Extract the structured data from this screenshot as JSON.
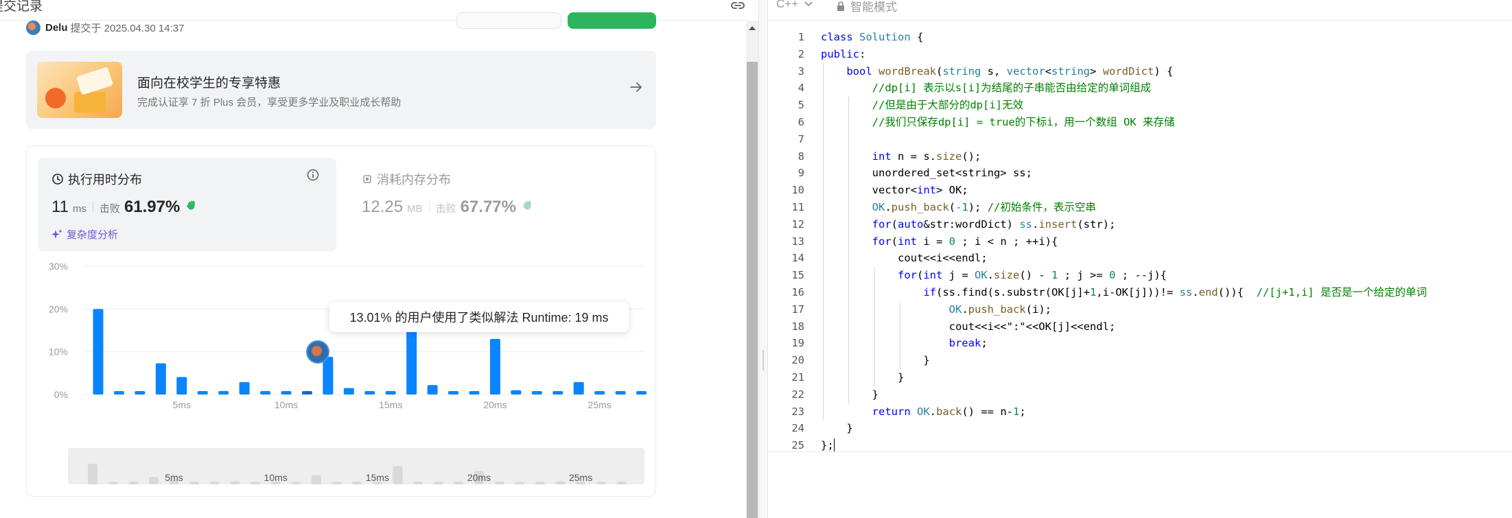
{
  "header": {
    "title": "提交记录"
  },
  "submission": {
    "author": "Delu",
    "submitted_at": "提交于 2025.04.30 14:37"
  },
  "promo": {
    "title": "面向在校学生的专享特惠",
    "subtitle": "完成认证享 7 折 Plus 会员，享受更多学业及职业成长帮助"
  },
  "runtime": {
    "title": "执行用时分布",
    "value": "11",
    "unit": "ms",
    "beat_label": "击败",
    "beat_pct": "61.97%",
    "complexity_label": "复杂度分析"
  },
  "memory": {
    "title": "消耗内存分布",
    "value": "12.25",
    "unit": "MB",
    "beat_label": "击败",
    "beat_pct": "67.77%"
  },
  "tooltip": {
    "text": "13.01% 的用户使用了类似解法 Runtime: 19 ms"
  },
  "chart_data": {
    "type": "bar",
    "xlabel": "",
    "ylabel": "",
    "ylim": [
      0,
      30
    ],
    "y_ticks": [
      "0%",
      "10%",
      "20%",
      "30%"
    ],
    "x_ticks": [
      "5ms",
      "10ms",
      "15ms",
      "20ms",
      "25ms"
    ],
    "x": [
      1,
      2,
      3,
      4,
      5,
      6,
      7,
      8,
      9,
      10,
      11,
      12,
      13,
      14,
      15,
      16,
      17,
      18,
      19,
      20,
      21,
      22,
      23,
      24,
      25,
      26,
      27
    ],
    "values": [
      20,
      0.8,
      0.8,
      7.3,
      4.1,
      0.8,
      0.8,
      2.9,
      0.8,
      0.8,
      0.8,
      8.8,
      1.5,
      0.8,
      0.8,
      18,
      2.2,
      0.8,
      0.8,
      13,
      1.0,
      0.8,
      0.8,
      2.9,
      0.8,
      0.8,
      0.8
    ],
    "highlight_x": 11,
    "grid": true
  },
  "editor": {
    "language": "C++",
    "mode": "智能模式",
    "lines": [
      [
        [
          "kw",
          "class "
        ],
        [
          "ty",
          "Solution"
        ],
        [
          "p",
          " {"
        ]
      ],
      [
        [
          "kw",
          "public"
        ],
        [
          "p",
          ":"
        ]
      ],
      [
        [
          "p",
          "    "
        ],
        [
          "kw",
          "bool "
        ],
        [
          "fn",
          "wordBreak"
        ],
        [
          "p",
          "("
        ],
        [
          "ty",
          "string"
        ],
        [
          "p",
          " s, "
        ],
        [
          "ty",
          "vector"
        ],
        [
          "p",
          "<"
        ],
        [
          "ty",
          "string"
        ],
        [
          "p",
          "&gt; "
        ],
        [
          "fn",
          "wordDict"
        ],
        [
          "p",
          ") {"
        ]
      ],
      [
        [
          "p",
          "        "
        ],
        [
          "cm",
          "//dp[i] 表示以s[i]为结尾的子串能否由给定的单词组成"
        ]
      ],
      [
        [
          "p",
          "        "
        ],
        [
          "cm",
          "//但是由于大部分的dp[i]无效"
        ]
      ],
      [
        [
          "p",
          "        "
        ],
        [
          "cm",
          "//我们只保存dp[i] = true的下标i，用一个数组 OK 来存储"
        ]
      ],
      [
        [
          "p",
          ""
        ]
      ],
      [
        [
          "p",
          "        "
        ],
        [
          "kw",
          "int"
        ],
        [
          "p",
          " n = s."
        ],
        [
          "fn",
          "size"
        ],
        [
          "p",
          "();"
        ]
      ],
      [
        [
          "p",
          "        unordered_set&lt;string&gt; ss;"
        ]
      ],
      [
        [
          "p",
          "        vector&lt;"
        ],
        [
          "kw",
          "int"
        ],
        [
          "p",
          "&gt; OK;"
        ]
      ],
      [
        [
          "p",
          "        "
        ],
        [
          "ty",
          "OK"
        ],
        [
          "p",
          "."
        ],
        [
          "fn",
          "push_back"
        ],
        [
          "p",
          "("
        ],
        [
          "nm",
          "-1"
        ],
        [
          "p",
          "); "
        ],
        [
          "cm",
          "//初始条件，表示空串"
        ]
      ],
      [
        [
          "p",
          "        "
        ],
        [
          "kw",
          "for"
        ],
        [
          "p",
          "("
        ],
        [
          "kw",
          "auto"
        ],
        [
          "p",
          "&amp;str:wordDict) "
        ],
        [
          "ty",
          "ss"
        ],
        [
          "p",
          "."
        ],
        [
          "fn",
          "insert"
        ],
        [
          "p",
          "(str);"
        ]
      ],
      [
        [
          "p",
          "        "
        ],
        [
          "kw",
          "for"
        ],
        [
          "p",
          "("
        ],
        [
          "kw",
          "int"
        ],
        [
          "p",
          " i = "
        ],
        [
          "nm",
          "0"
        ],
        [
          "p",
          " ; i &lt; n ; ++i){"
        ]
      ],
      [
        [
          "p",
          "            cout&lt;&lt;i&lt;&lt;endl;"
        ]
      ],
      [
        [
          "p",
          "            "
        ],
        [
          "kw",
          "for"
        ],
        [
          "p",
          "("
        ],
        [
          "kw",
          "int"
        ],
        [
          "p",
          " j = "
        ],
        [
          "ty",
          "OK"
        ],
        [
          "p",
          "."
        ],
        [
          "fn",
          "size"
        ],
        [
          "p",
          "() - "
        ],
        [
          "nm",
          "1"
        ],
        [
          "p",
          " ; j &gt;= "
        ],
        [
          "nm",
          "0"
        ],
        [
          "p",
          " ; --j){"
        ]
      ],
      [
        [
          "p",
          "                "
        ],
        [
          "kw",
          "if"
        ],
        [
          "p",
          "(ss.find(s.substr(OK[j]+"
        ],
        [
          "nm",
          "1"
        ],
        [
          "p",
          ",i-OK[j]))!= "
        ],
        [
          "ty",
          "ss"
        ],
        [
          "p",
          "."
        ],
        [
          "fn",
          "end"
        ],
        [
          "p",
          "()){  "
        ],
        [
          "cm",
          "//[j+1,i] 是否是一个给定的单词"
        ]
      ],
      [
        [
          "p",
          "                    "
        ],
        [
          "ty",
          "OK"
        ],
        [
          "p",
          "."
        ],
        [
          "fn",
          "push_back"
        ],
        [
          "p",
          "(i);"
        ]
      ],
      [
        [
          "p",
          "                    cout&lt;&lt;i&lt;&lt;\":\"&lt;&lt;OK[j]&lt;&lt;endl;"
        ]
      ],
      [
        [
          "p",
          "                    "
        ],
        [
          "kw",
          "break"
        ],
        [
          "p",
          ";"
        ]
      ],
      [
        [
          "p",
          "                }"
        ]
      ],
      [
        [
          "p",
          "            }"
        ]
      ],
      [
        [
          "p",
          "        }"
        ]
      ],
      [
        [
          "p",
          "        "
        ],
        [
          "kw",
          "return "
        ],
        [
          "ty",
          "OK"
        ],
        [
          "p",
          "."
        ],
        [
          "fn",
          "back"
        ],
        [
          "p",
          "() == n-"
        ],
        [
          "nm",
          "1"
        ],
        [
          "p",
          ";"
        ]
      ],
      [
        [
          "p",
          "    }"
        ]
      ],
      [
        [
          "p",
          "};"
        ]
      ]
    ]
  },
  "colors": {
    "bar": "#0a84ff",
    "bar_highlight": "#1d66c4",
    "keyword": "#0000ff",
    "type": "#267f99",
    "function": "#795e26",
    "comment": "#008000",
    "number": "#098658"
  }
}
